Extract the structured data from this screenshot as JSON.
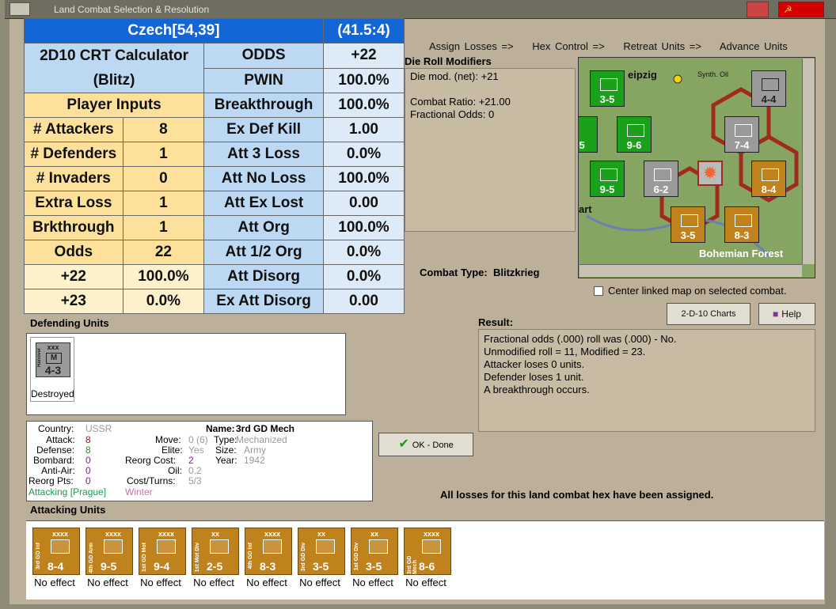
{
  "window": {
    "title": "Land Combat Selection & Resolution"
  },
  "crt": {
    "region": "Czech[54,39]",
    "ratio": "(41.5:4)",
    "calc_title": "2D10 CRT Calculator",
    "calc_mode": "(Blitz)",
    "player_inputs": "Player Inputs",
    "rows": [
      {
        "label": "# Attackers",
        "val": "8"
      },
      {
        "label": "# Defenders",
        "val": "1"
      },
      {
        "label": "# Invaders",
        "val": "0"
      },
      {
        "label": "Extra Loss",
        "val": "1"
      },
      {
        "label": "Brkthrough",
        "val": "1"
      },
      {
        "label": "Odds",
        "val": "22"
      },
      {
        "label": "+22",
        "val": "100.0%"
      },
      {
        "label": "+23",
        "val": "0.0%"
      }
    ],
    "results": [
      {
        "label": "ODDS",
        "val": "+22"
      },
      {
        "label": "PWIN",
        "val": "100.0%"
      },
      {
        "label": "Breakthrough",
        "val": "100.0%"
      },
      {
        "label": "Ex Def Kill",
        "val": "1.00"
      },
      {
        "label": "Att 3 Loss",
        "val": "0.0%"
      },
      {
        "label": "Att No Loss",
        "val": "100.0%"
      },
      {
        "label": "Att Ex Lost",
        "val": "0.00"
      },
      {
        "label": "Att Org",
        "val": "100.0%"
      },
      {
        "label": "Att 1/2 Org",
        "val": "0.0%"
      },
      {
        "label": "Att Disorg",
        "val": "0.0%"
      },
      {
        "label": "Ex Att Disorg",
        "val": "0.00"
      }
    ]
  },
  "steps": [
    "Assign Losses =>",
    "Hex Control =>",
    "Retreat Units =>",
    "Advance Units"
  ],
  "die": {
    "header": "Die Roll Modifiers",
    "l1": "Die mod. (net): +21",
    "l2": "Combat Ratio: +21.00",
    "l3": "Fractional Odds: 0"
  },
  "map": {
    "places": [
      "eipzig",
      "Synth. Oil",
      "Bohemian Forest",
      "art"
    ],
    "units": [
      "3-5",
      "4-4",
      "9-6",
      "7-4",
      "9-5",
      "6-2",
      "8-4",
      "3-5",
      "8-3",
      "-5"
    ]
  },
  "combat_type": {
    "label": "Combat Type:",
    "value": "Blitzkrieg"
  },
  "center_linked": "Center linked map on selected combat.",
  "buttons": {
    "charts": "2-D-10 Charts",
    "help": "Help",
    "ok": "OK - Done"
  },
  "result": {
    "header": "Result:",
    "lines": [
      "Fractional odds (.000) roll was (.000)  - No.",
      "Unmodified roll = 11, Modified = 23.",
      "Attacker loses 0 units.",
      "Defender loses 1 unit.",
      "A breakthrough occurs."
    ]
  },
  "defending": {
    "header": "Defending Units",
    "unit": {
      "name": "Hanover",
      "size": "xxx",
      "val": "4-3",
      "status": "Destroyed"
    }
  },
  "info": {
    "country_l": "Country:",
    "country": "USSR",
    "attack_l": "Attack:",
    "attack": "8",
    "defense_l": "Defense:",
    "defense": "8",
    "bombard_l": "Bombard:",
    "bombard": "0",
    "antiair_l": "Anti-Air:",
    "antiair": "0",
    "reorgpts_l": "Reorg Pts:",
    "reorgpts": "0",
    "move_l": "Move:",
    "move": "0 (6)",
    "elite_l": "Elite:",
    "elite": "Yes",
    "reorgcost_l": "Reorg Cost:",
    "reorgcost": "2",
    "oil_l": "Oil:",
    "oil": "0.2",
    "costturns_l": "Cost/Turns:",
    "costturns": "5/3",
    "name_l": "Name:",
    "name": "3rd GD Mech",
    "type_l": "Type:",
    "type": "Mechanized",
    "size_l": "Size:",
    "size": "Army",
    "year_l": "Year:",
    "year": "1942",
    "attacking": "Attacking [Prague]",
    "season": "Winter"
  },
  "all_losses": "All losses for this land combat hex have been assigned.",
  "attacking": {
    "header": "Attacking Units",
    "units": [
      {
        "name": "3rd GD Inf",
        "size": "xxxx",
        "val": "8-4",
        "effect": "No effect"
      },
      {
        "name": "4th GD Arm",
        "size": "xxxx",
        "val": "9-5",
        "effect": "No effect"
      },
      {
        "name": "1st GD Mot",
        "size": "xxxx",
        "val": "9-4",
        "effect": "No effect"
      },
      {
        "name": "1st Mot Div",
        "size": "xx",
        "val": "2-5",
        "effect": "No effect"
      },
      {
        "name": "4th GD Inf",
        "size": "xxxx",
        "val": "8-3",
        "effect": "No effect"
      },
      {
        "name": "3rd GD Div",
        "size": "xx",
        "val": "3-5",
        "effect": "No effect"
      },
      {
        "name": "1st GD Div",
        "size": "xx",
        "val": "3-5",
        "effect": "No effect"
      },
      {
        "name": "3rd GD Mech",
        "size": "xxxx",
        "val": "8-6",
        "effect": "No effect"
      }
    ]
  },
  "colors": {
    "accent_blue": "#1366d6",
    "attack_red": "#d40000",
    "defense_green": "#1a9a1a",
    "bombard_purple": "#b000b0",
    "winter_pink": "#d070a0"
  }
}
